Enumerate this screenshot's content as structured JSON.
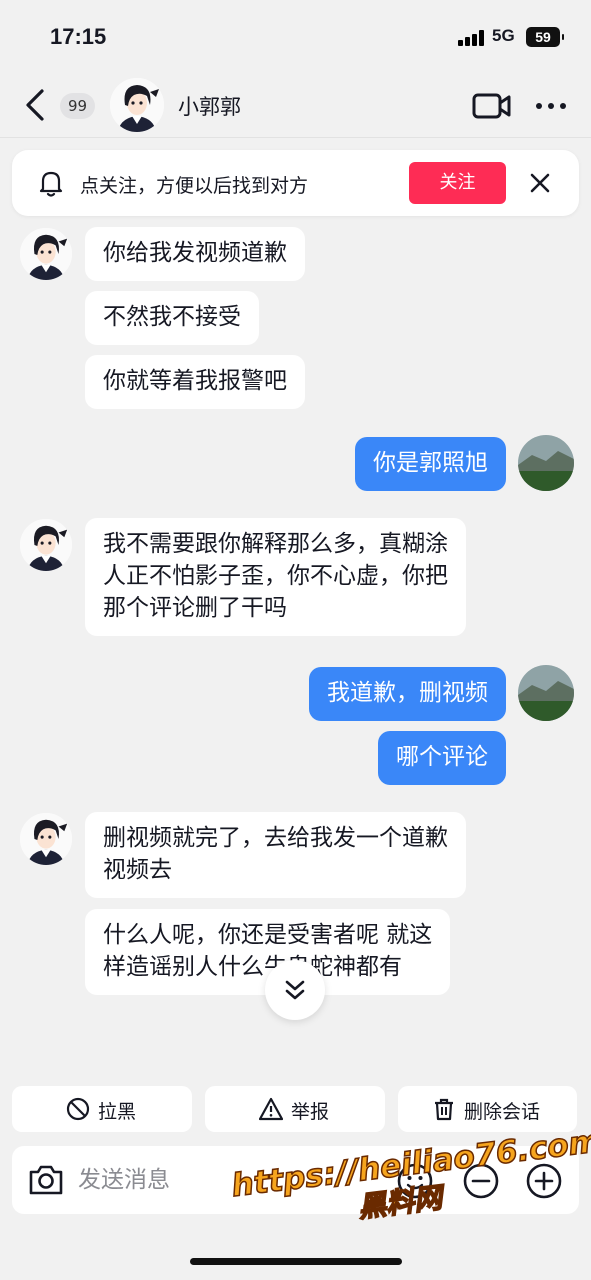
{
  "status": {
    "time": "17:15",
    "network": "5G",
    "battery": "59"
  },
  "header": {
    "unread_count": "99",
    "contact_name": "小郭郭"
  },
  "follow_banner": {
    "text": "点关注，方便以后找到对方",
    "button": "关注"
  },
  "messages": [
    {
      "side": "them",
      "text": "你给我发视频道歉"
    },
    {
      "side": "them",
      "text": "不然我不接受"
    },
    {
      "side": "them",
      "text": "你就等着我报警吧"
    },
    {
      "side": "me",
      "text": "你是郭照旭"
    },
    {
      "side": "them",
      "text": "我不需要跟你解释那么多，真糊涂\n人正不怕影子歪，你不心虚，你把\n那个评论删了干吗"
    },
    {
      "side": "me",
      "text": "我道歉，删视频"
    },
    {
      "side": "me",
      "text": "哪个评论"
    },
    {
      "side": "them",
      "text": "删视频就完了，去给我发一个道歉\n视频去"
    },
    {
      "side": "them",
      "text": "什么人呢，你还是受害者呢 就这\n样造谣别人什么牛鬼蛇神都有"
    }
  ],
  "actions": {
    "block": "拉黑",
    "report": "举报",
    "delete": "删除会话"
  },
  "input": {
    "placeholder": "发送消息"
  },
  "watermark": {
    "url": "https://heiliao76.com",
    "name": "黑料网"
  },
  "icons": {
    "back": "back-arrow-icon",
    "video": "video-call-icon",
    "more": "more-icon",
    "bell": "bell-icon",
    "close": "close-icon",
    "scroll": "chevrons-down-icon",
    "block": "block-icon",
    "report": "warning-icon",
    "delete": "trash-icon",
    "camera": "camera-icon",
    "emoji": "emoji-icon",
    "plus": "plus-icon"
  },
  "colors": {
    "accent": "#fe2c55",
    "my_bubble": "#3a87f8",
    "background": "#f1f1f1"
  }
}
